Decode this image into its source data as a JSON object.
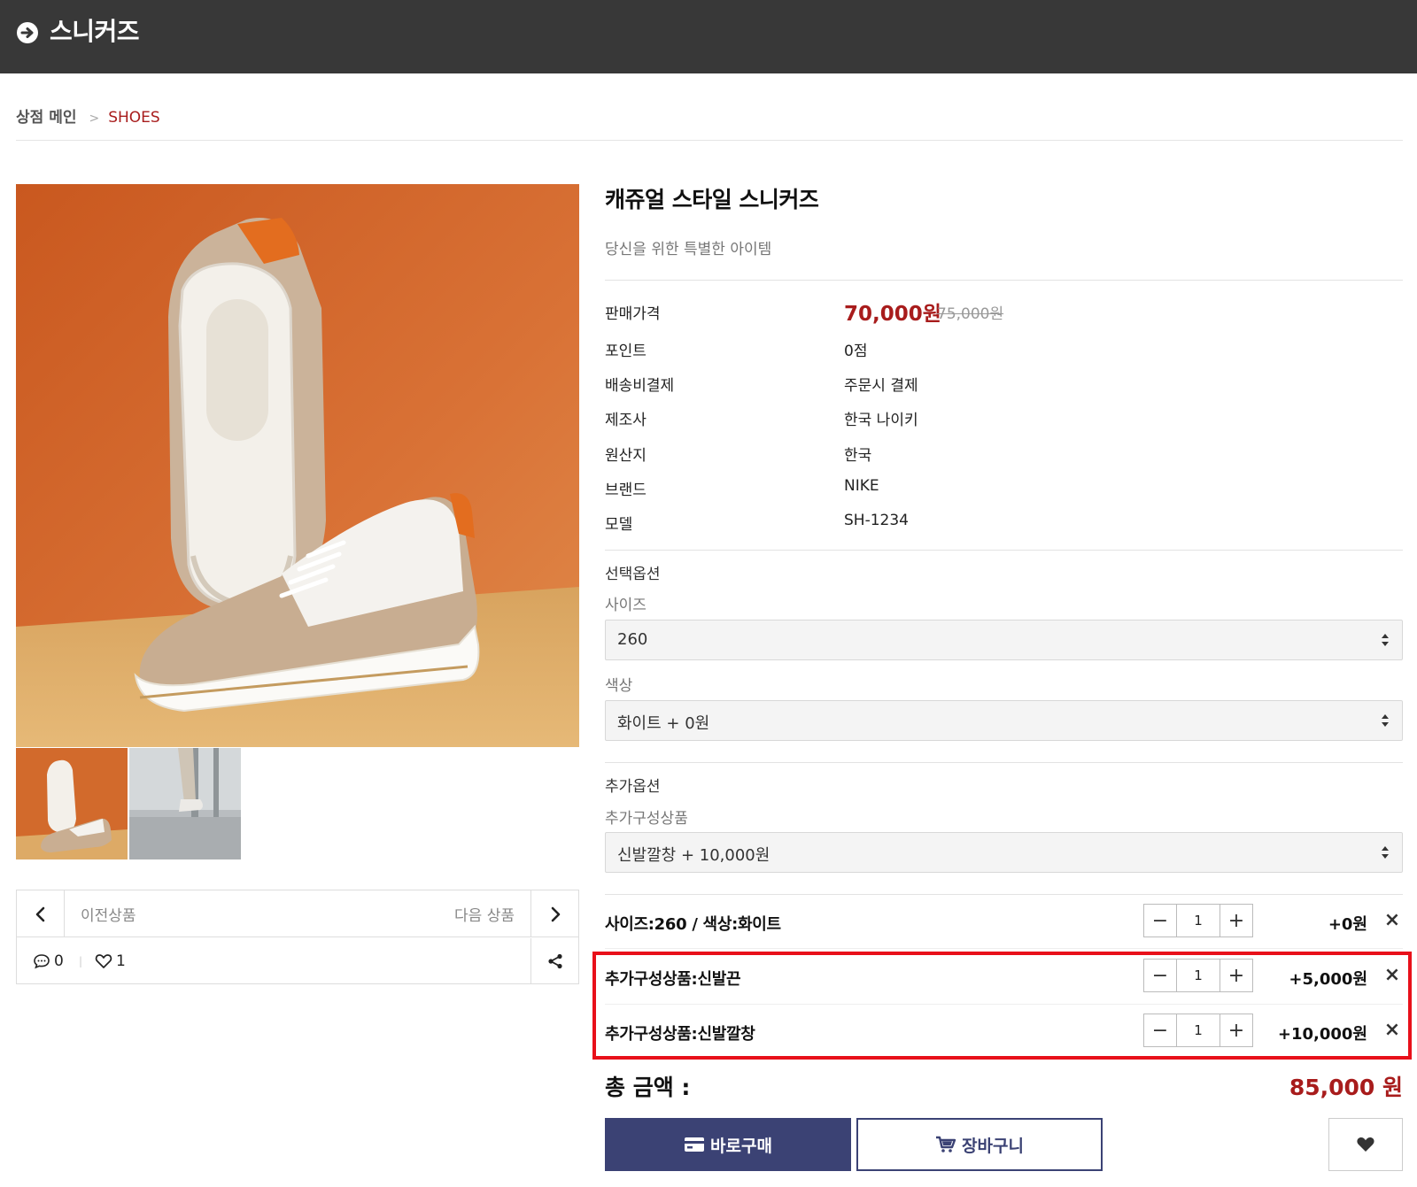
{
  "header": {
    "title": "스니커즈",
    "back_icon": "arrow-circle-right-icon"
  },
  "breadcrumb": {
    "home": "상점 메인",
    "separator": ">",
    "current": "SHOES"
  },
  "product": {
    "name": "캐쥬얼 스타일 스니커즈",
    "subtitle": "당신을 위한 특별한 아이템",
    "price_label": "판매가격",
    "price": "70,000원",
    "original_price": "75,000원",
    "info": [
      {
        "key": "포인트",
        "value": "0점"
      },
      {
        "key": "배송비결제",
        "value": "주문시 결제"
      },
      {
        "key": "제조사",
        "value": "한국 나이키"
      },
      {
        "key": "원산지",
        "value": "한국"
      },
      {
        "key": "브랜드",
        "value": "NIKE"
      },
      {
        "key": "모델",
        "value": "SH-1234"
      }
    ]
  },
  "options": {
    "section_label": "선택옵션",
    "size_label": "사이즈",
    "size_value": "260",
    "color_label": "색상",
    "color_value": "화이트  + 0원"
  },
  "extra_options": {
    "section_label": "추가옵션",
    "item_label": "추가구성상품",
    "item_value": "신발깔창  + 10,000원"
  },
  "selected": [
    {
      "name": "사이즈:260 / 색상:화이트",
      "qty": "1",
      "price": "+0원"
    },
    {
      "name": "추가구성상품:신발끈",
      "qty": "1",
      "price": "+5,000원"
    },
    {
      "name": "추가구성상품:신발깔창",
      "qty": "1",
      "price": "+10,000원"
    }
  ],
  "stepper": {
    "minus": "−",
    "plus": "+",
    "remove": "×"
  },
  "total": {
    "label": "총 금액 :",
    "value": "85,000 원"
  },
  "buttons": {
    "buy": "바로구매",
    "cart": "장바구니"
  },
  "nav": {
    "prev": "이전상품",
    "next": "다음 상품",
    "comments": "0",
    "likes": "1"
  },
  "colors": {
    "header_bg": "#383838",
    "accent_red": "#a81c1c",
    "button_navy": "#3b4274",
    "highlight": "#e8101a"
  }
}
